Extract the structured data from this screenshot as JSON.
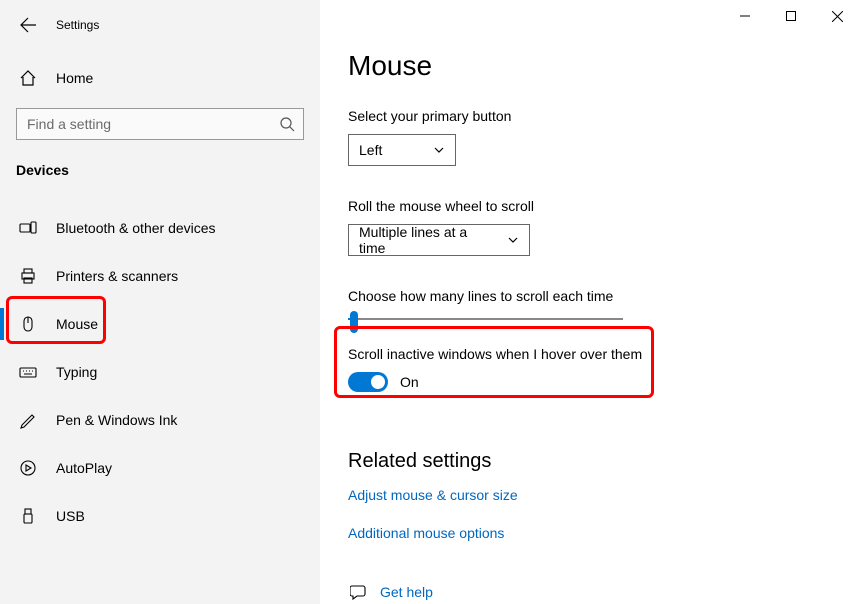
{
  "app_title": "Settings",
  "home_label": "Home",
  "search_placeholder": "Find a setting",
  "section_header": "Devices",
  "nav": {
    "items": [
      {
        "label": "Bluetooth & other devices"
      },
      {
        "label": "Printers & scanners"
      },
      {
        "label": "Mouse"
      },
      {
        "label": "Typing"
      },
      {
        "label": "Pen & Windows Ink"
      },
      {
        "label": "AutoPlay"
      },
      {
        "label": "USB"
      }
    ]
  },
  "main": {
    "title": "Mouse",
    "primary_button_label": "Select your primary button",
    "primary_button_value": "Left",
    "wheel_label": "Roll the mouse wheel to scroll",
    "wheel_value": "Multiple lines at a time",
    "lines_label": "Choose how many lines to scroll each time",
    "hover_label": "Scroll inactive windows when I hover over them",
    "hover_state": "On",
    "related_heading": "Related settings",
    "link_adjust": "Adjust mouse & cursor size",
    "link_additional": "Additional mouse options",
    "get_help": "Get help"
  }
}
